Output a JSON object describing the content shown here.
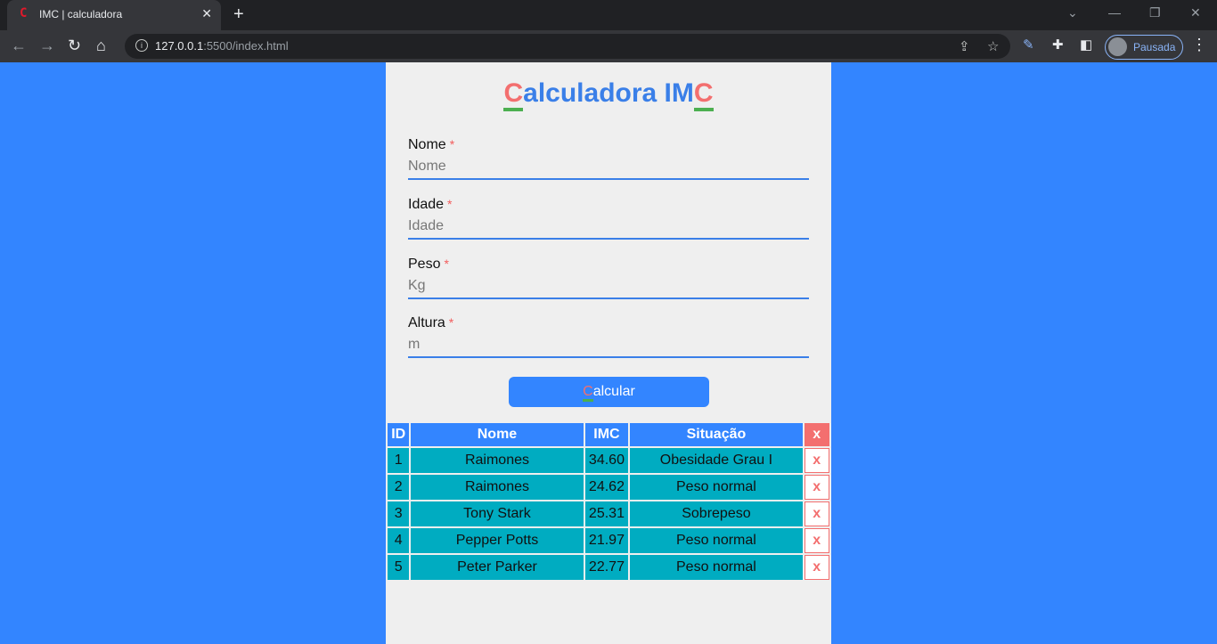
{
  "browser": {
    "tab_icon": "C",
    "tab_title": "IMC | calculadora",
    "url_host": "127.0.0.1",
    "url_rest": ":5500/index.html",
    "profile_label": "Pausada"
  },
  "page": {
    "title_first": "C",
    "title_middle": "alculadora IM",
    "title_last": "C",
    "fields": [
      {
        "label": "Nome",
        "required": "*",
        "placeholder": "Nome"
      },
      {
        "label": "Idade",
        "required": "*",
        "placeholder": "Idade"
      },
      {
        "label": "Peso",
        "required": "*",
        "placeholder": "Kg"
      },
      {
        "label": "Altura",
        "required": "*",
        "placeholder": "m"
      }
    ],
    "button_first": "C",
    "button_rest": "alcular"
  },
  "table": {
    "headers": [
      "ID",
      "Nome",
      "IMC",
      "Situação",
      "x"
    ],
    "rows": [
      {
        "id": "1",
        "nome": "Raimones",
        "imc": "34.60",
        "situacao": "Obesidade Grau I",
        "del": "x"
      },
      {
        "id": "2",
        "nome": "Raimones",
        "imc": "24.62",
        "situacao": "Peso normal",
        "del": "x"
      },
      {
        "id": "3",
        "nome": "Tony Stark",
        "imc": "25.31",
        "situacao": "Sobrepeso",
        "del": "x"
      },
      {
        "id": "4",
        "nome": "Pepper Potts",
        "imc": "21.97",
        "situacao": "Peso normal",
        "del": "x"
      },
      {
        "id": "5",
        "nome": "Peter Parker",
        "imc": "22.77",
        "situacao": "Peso normal",
        "del": "x"
      }
    ]
  },
  "colors": {
    "page_bg": "#3385ff",
    "card_bg": "#efefef",
    "accent_red": "#f36f6f",
    "accent_green": "#4caf50",
    "row_bg": "#00acc1"
  }
}
